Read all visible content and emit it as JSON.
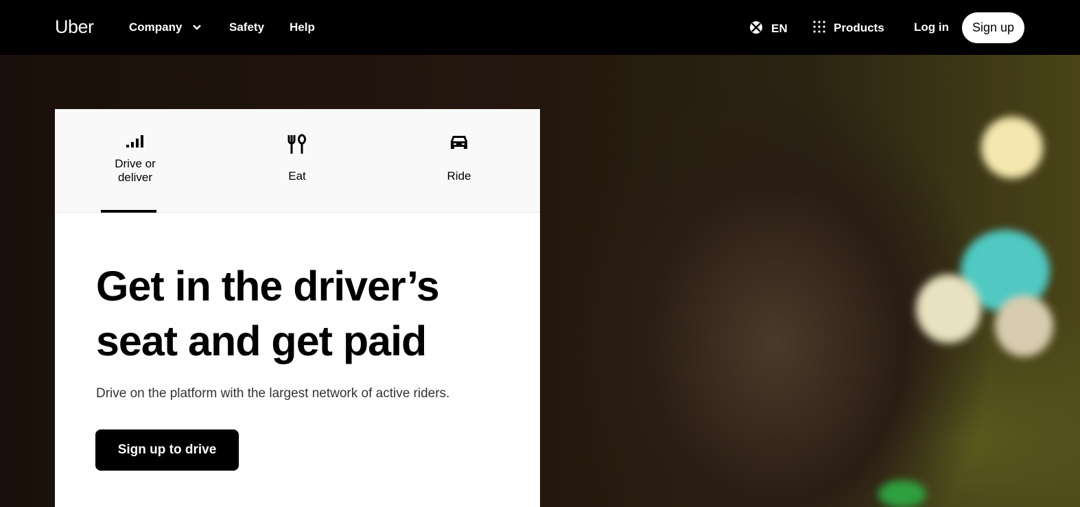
{
  "nav": {
    "logo": "Uber",
    "company": "Company",
    "safety": "Safety",
    "help": "Help",
    "language": "EN",
    "products": "Products",
    "login": "Log in",
    "signup": "Sign up"
  },
  "tabs": [
    {
      "label": "Drive or deliver"
    },
    {
      "label": "Eat"
    },
    {
      "label": "Ride"
    }
  ],
  "hero": {
    "title": "Get in the driver’s seat and get paid",
    "subtitle": "Drive on the platform with the largest network of active riders.",
    "cta": "Sign up to drive"
  }
}
